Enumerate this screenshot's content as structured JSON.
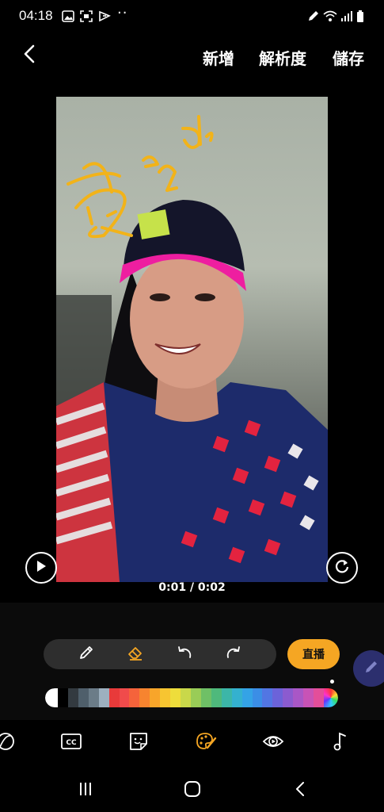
{
  "status_bar": {
    "time": "04:18",
    "dots": "··",
    "icons": [
      "image-icon",
      "screenshot-icon",
      "app-notification-icon",
      "pen-icon",
      "wifi-icon",
      "signal-icon",
      "battery-icon"
    ]
  },
  "header": {
    "back_icon": "back-arrow-icon",
    "new_label": "新增",
    "resolution_label": "解析度",
    "save_label": "儲存"
  },
  "video": {
    "time_display": "0:01 / 0:02",
    "play_icon": "play-icon",
    "rotate_icon": "rotate-icon"
  },
  "drawing_tools": {
    "tools": [
      "pen-icon",
      "eraser-icon",
      "undo-icon",
      "redo-icon"
    ],
    "selected_tool": "eraser-icon",
    "live_label": "直播",
    "accent_color": "#f5a623"
  },
  "palette": {
    "colors": [
      "#000000",
      "#333a40",
      "#4f5f6b",
      "#6b7c88",
      "#9db0bf",
      "#e83a3a",
      "#f04b4b",
      "#f5633b",
      "#f7842f",
      "#f8a52a",
      "#f7c531",
      "#eedd3b",
      "#c9d84a",
      "#99cc57",
      "#6fc066",
      "#4fb97c",
      "#3cb6a8",
      "#34b1cf",
      "#34a3e6",
      "#3b8ee6",
      "#5276e3",
      "#6c63d9",
      "#8b5bcf",
      "#a957c6",
      "#c853b6",
      "#e34e9a"
    ]
  },
  "bottom_tools": [
    "sticker-crop-icon",
    "cc-icon",
    "sticker-icon",
    "paint-palette-icon",
    "eye-play-icon",
    "music-note-icon"
  ],
  "selected_bottom_tool": "paint-palette-icon",
  "nav_bar": [
    "recent-apps-icon",
    "home-icon",
    "back-icon"
  ]
}
